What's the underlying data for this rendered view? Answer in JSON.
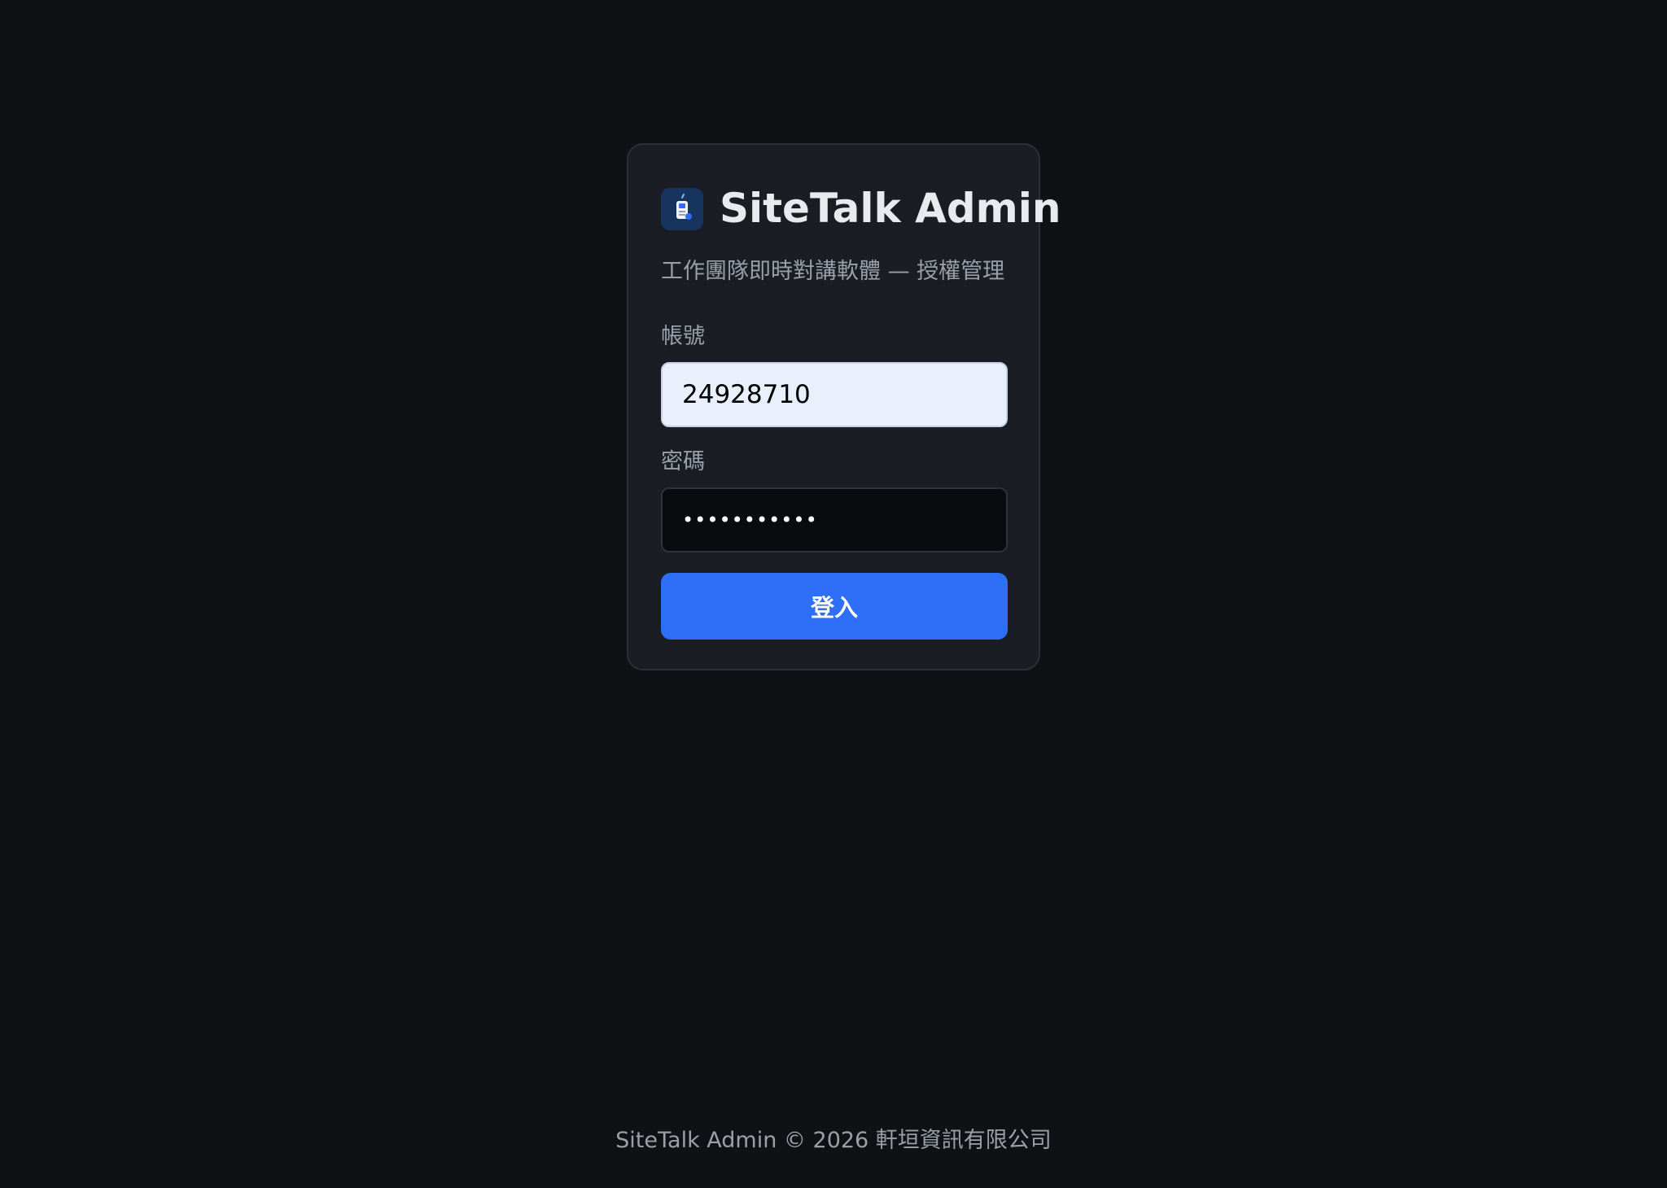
{
  "app": {
    "title": "SiteTalk Admin",
    "subtitle": "工作團隊即時對講軟體 — 授權管理",
    "logo_icon": "walkie-talkie-icon"
  },
  "form": {
    "account_label": "帳號",
    "account_value": "24928710",
    "password_label": "密碼",
    "password_masked": "•••••••••••",
    "login_label": "登入"
  },
  "footer": {
    "text": "SiteTalk Admin © 2026 軒垣資訊有限公司"
  },
  "colors": {
    "background": "#0f1115",
    "card": "#1a1d23",
    "accent": "#2f6ef6",
    "account_input_bg": "#e9effb"
  }
}
